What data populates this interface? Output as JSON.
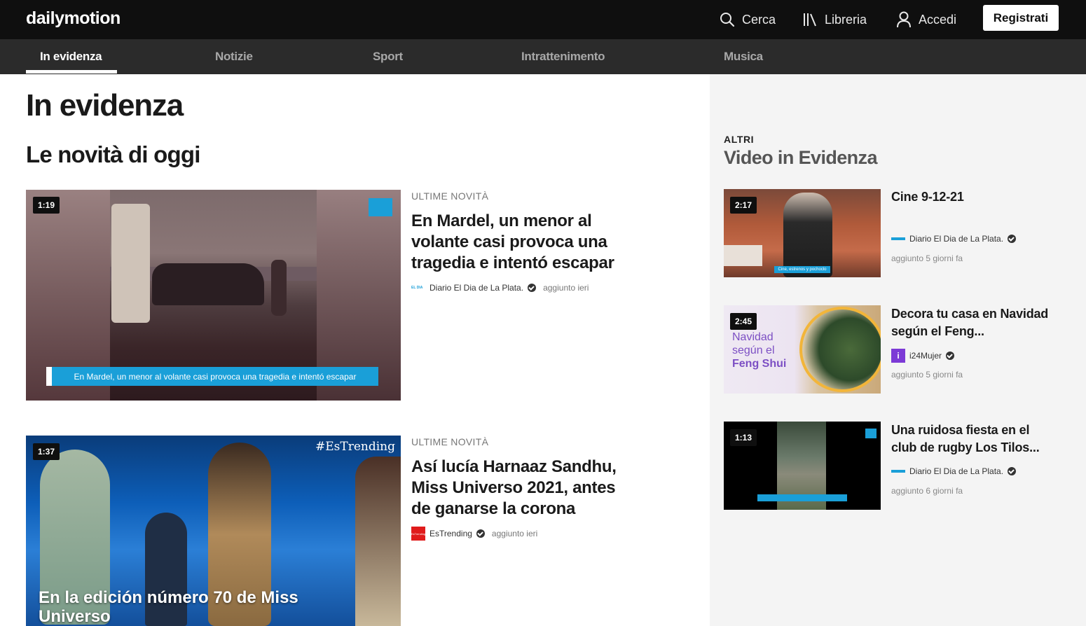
{
  "header": {
    "logo": "dailymotion",
    "search_label": "Cerca",
    "library_label": "Libreria",
    "login_label": "Accedi",
    "signup_label": "Registrati"
  },
  "nav": {
    "tabs": [
      {
        "label": "In evidenza",
        "active": true
      },
      {
        "label": "Notizie"
      },
      {
        "label": "Sport"
      },
      {
        "label": "Intrattenimento"
      },
      {
        "label": "Musica"
      }
    ]
  },
  "main": {
    "page_title": "In evidenza",
    "section_title": "Le novità di oggi",
    "videos": [
      {
        "duration": "1:19",
        "category": "ULTIME NOVITÀ",
        "title": "En Mardel, un menor al volante casi provoca una tragedia e intentó escapar",
        "caption": "En Mardel, un menor al volante casi provoca una tragedia e intentó escapar",
        "channel_logo": "EL DIA",
        "channel": "Diario El Dia de La Plata.",
        "added": "aggiunto ieri"
      },
      {
        "duration": "1:37",
        "category": "ULTIME NOVITÀ",
        "title": "Así lucía Harnaaz Sandhu, Miss Universo 2021, antes de ganarse la corona",
        "caption": "En la edición número 70 de Miss Universo",
        "watermark": "#EsTrending",
        "channel_logo": "EsTrending",
        "channel": "EsTrending",
        "added": "aggiunto ieri"
      }
    ]
  },
  "sidebar": {
    "kicker": "ALTRI",
    "title": "Video in Evidenza",
    "videos": [
      {
        "duration": "2:17",
        "title": "Cine 9-12-21",
        "channel": "Diario El Dia de La Plata.",
        "added": "aggiunto 5 giorni fa",
        "thumb_caption": "Cine, estrenos y pochoclo"
      },
      {
        "duration": "2:45",
        "title": "Decora tu casa en Navidad según el Feng...",
        "channel": "i24Mujer",
        "added": "aggiunto 5 giorni fa",
        "thumb_text": [
          "Navidad",
          "según el",
          "Feng Shui"
        ]
      },
      {
        "duration": "1:13",
        "title": "Una ruidosa fiesta en el club de rugby Los Tilos...",
        "channel": "Diario El Dia de La Plata.",
        "added": "aggiunto 6 giorni fa"
      }
    ]
  },
  "colors": {
    "topbar": "#0f0f0f",
    "nav": "#2b2b2b",
    "sidebar_bg": "#f4f4f4",
    "caption_blue": "#1a9fd8"
  },
  "icons": [
    "search-icon",
    "library-icon",
    "user-icon",
    "verified-icon"
  ]
}
